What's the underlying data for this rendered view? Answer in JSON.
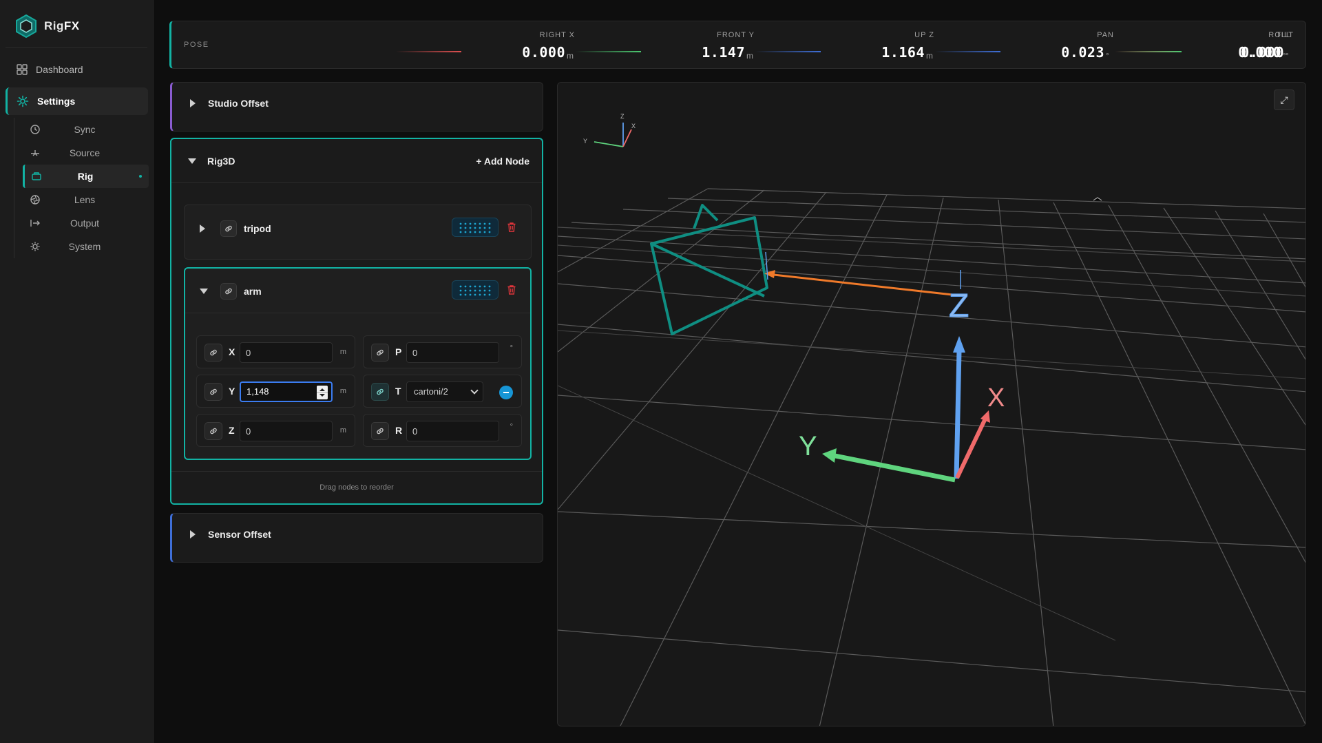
{
  "app": {
    "name_prefix": "Rig",
    "name_suffix": "FX"
  },
  "nav": {
    "dashboard": "Dashboard",
    "settings": "Settings",
    "sub_items": [
      {
        "label": "Sync",
        "icon": "clock-icon"
      },
      {
        "label": "Source",
        "icon": "source-icon"
      },
      {
        "label": "Rig",
        "icon": "camera-rig-icon",
        "active": true
      },
      {
        "label": "Lens",
        "icon": "aperture-icon"
      },
      {
        "label": "Output",
        "icon": "output-arrow-icon"
      },
      {
        "label": "System",
        "icon": "gear-icon"
      }
    ]
  },
  "pose": {
    "title": "POSE",
    "items": [
      {
        "label": "RIGHT X",
        "value": "0.000",
        "unit": "m",
        "color": "#e05050"
      },
      {
        "label": "FRONT Y",
        "value": "1.147",
        "unit": "m",
        "color": "#4cc870"
      },
      {
        "label": "UP Z",
        "value": "1.164",
        "unit": "m",
        "color": "#3f6fd8"
      },
      {
        "label": "PAN",
        "value": "0.023",
        "unit": "°",
        "color": "#3f6fd8"
      },
      {
        "label": "TILT",
        "value": "0.000",
        "unit": "°",
        "color": "#e05050"
      },
      {
        "label": "ROLL",
        "value": "0.000",
        "unit": "°",
        "color": "#4cc870"
      }
    ]
  },
  "panels": {
    "studio_offset": "Studio Offset",
    "rig3d": "Rig3D",
    "add_node": "+ Add Node",
    "sensor_offset": "Sensor Offset",
    "drag_hint": "Drag nodes to reorder"
  },
  "nodes": {
    "tripod": {
      "name": "tripod"
    },
    "arm": {
      "name": "arm",
      "fields": {
        "x": {
          "label": "X",
          "value": "0",
          "unit": "m"
        },
        "y": {
          "label": "Y",
          "value": "1,148",
          "unit": "m"
        },
        "z": {
          "label": "Z",
          "value": "0",
          "unit": "m"
        },
        "p": {
          "label": "P",
          "value": "0",
          "unit": "°"
        },
        "t": {
          "label": "T",
          "value": "cartoni/2"
        },
        "r": {
          "label": "R",
          "value": "0",
          "unit": "°"
        }
      }
    }
  },
  "viewport": {
    "axis_labels": {
      "x": "X",
      "y": "Y",
      "z": "Z"
    },
    "expand_icon": "⤢",
    "colors": {
      "x": "#f06a6a",
      "y": "#5fd47e",
      "z": "#5fa1f0",
      "accent": "#12b3a4",
      "orange": "#f07a2a"
    }
  }
}
